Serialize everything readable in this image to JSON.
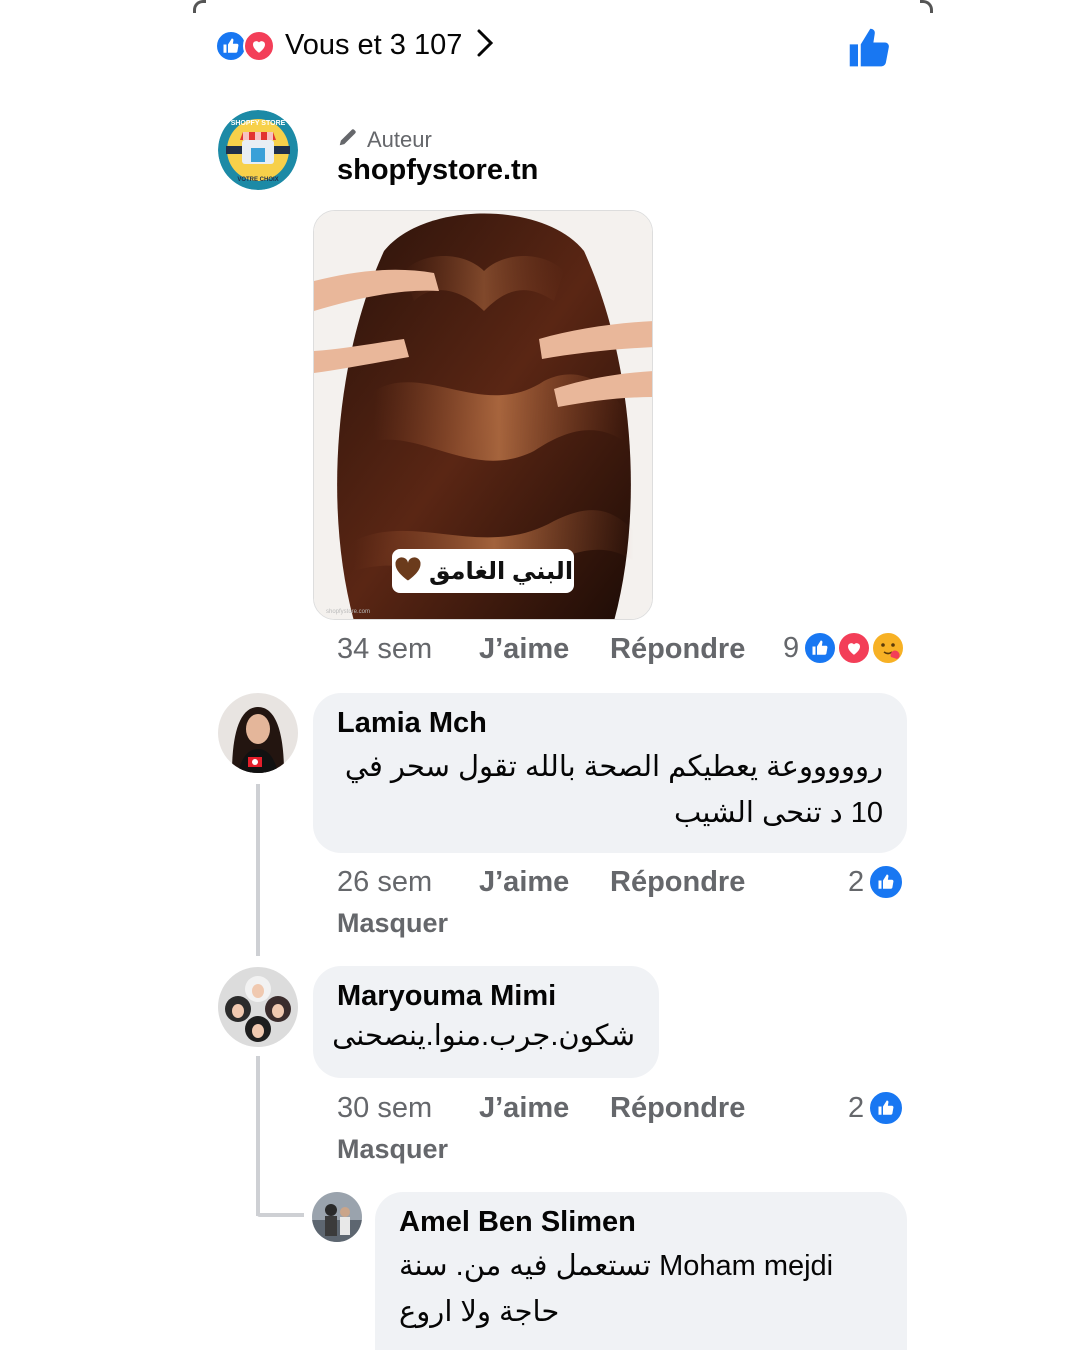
{
  "header": {
    "reactions_text": "Vous et 3 107",
    "icons": [
      "like-icon",
      "love-icon",
      "chevron-right-icon",
      "like-button-icon"
    ]
  },
  "author_comment": {
    "badge": "Auteur",
    "name": "shopfystore.tn",
    "avatar_logo_text": [
      "SHOPFY STORE",
      "VOTRE CHOIX"
    ],
    "photo_caption": "البني الغامق",
    "photo_watermark": "shopfystore.com",
    "time": "34 sem",
    "like": "J’aime",
    "reply": "Répondre",
    "reaction_count": "9"
  },
  "comments": [
    {
      "name": "Lamia Mch",
      "text": "روووووعة يعطيكم الصحة بالله تقول سحر في 10 د تنحى الشيب",
      "time": "26 sem",
      "like": "J’aime",
      "reply": "Répondre",
      "hide": "Masquer",
      "reaction_count": "2"
    },
    {
      "name": "Maryouma Mimi",
      "text": "شكون.جرب.منوا.ينصحنى",
      "time": "30 sem",
      "like": "J’aime",
      "reply": "Répondre",
      "hide": "Masquer",
      "reaction_count": "2"
    },
    {
      "name": "Amel Ben Slimen",
      "text_line1": "تستعمل فيه من. سنة Moham mejdi",
      "text_line2": "حاجة ولا اروع"
    }
  ],
  "colors": {
    "facebook_blue": "#1877f2",
    "love_red": "#f33e58",
    "bubble_bg": "#f0f2f5",
    "meta_grey": "#65676b"
  }
}
